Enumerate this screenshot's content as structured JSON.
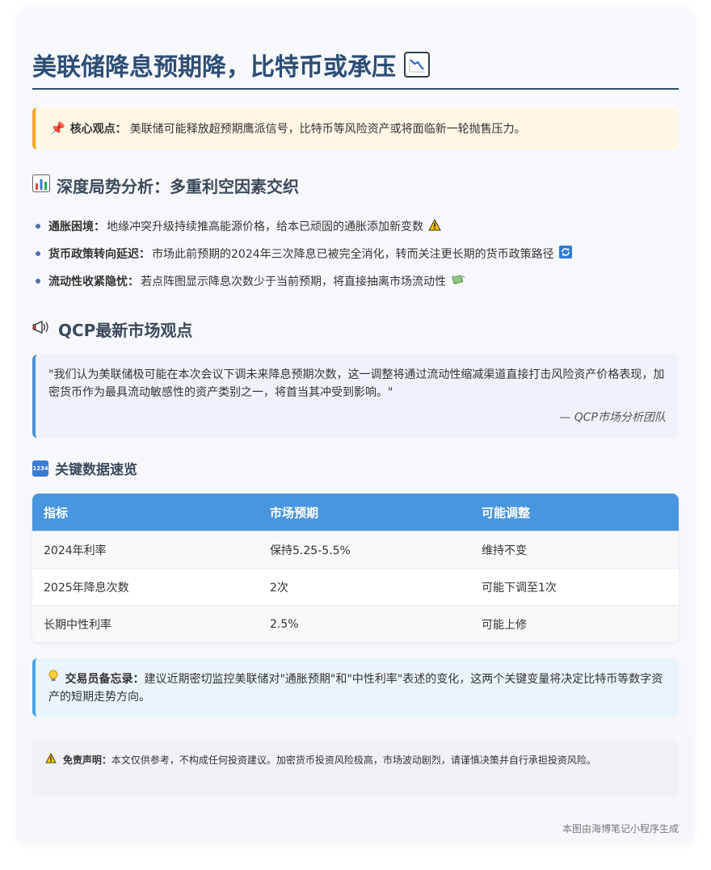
{
  "title": "美联储降息预期降，比特币或承压",
  "title_icon": "chart-decreasing-icon",
  "core": {
    "label": "核心观点：",
    "text": "美联储可能释放超预期鹰派信号，比特币等风险资产或将面临新一轮抛售压力。"
  },
  "analysis": {
    "heading": "深度局势分析：多重利空因素交织",
    "items": [
      {
        "label": "通胀困境：",
        "text": "地缘冲突升级持续推高能源价格，给本已顽固的通胀添加新变数",
        "icon": "warning-icon"
      },
      {
        "label": "货币政策转向延迟：",
        "text": "市场此前预期的2024年三次降息已被完全消化，转而关注更长期的货币政策路径",
        "icon": "refresh-icon"
      },
      {
        "label": "流动性收紧隐忧：",
        "text": "若点阵图显示降息次数少于当前预期，将直接抽离市场流动性",
        "icon": "money-wings-icon"
      }
    ]
  },
  "qcp": {
    "heading": "QCP最新市场观点",
    "quote": "\"我们认为美联储极可能在本次会议下调未来降息预期次数，这一调整将通过流动性缩减渠道直接打击风险资产价格表现，加密货币作为最具流动敏感性的资产类别之一，将首当其冲受到影响。\"",
    "source": "— QCP市场分析团队"
  },
  "data_section": {
    "heading": "关键数据速览",
    "num_icon": "1234",
    "columns": [
      "指标",
      "市场预期",
      "可能调整"
    ],
    "rows": [
      [
        "2024年利率",
        "保持5.25-5.5%",
        "维持不变"
      ],
      [
        "2025年降息次数",
        "2次",
        "可能下调至1次"
      ],
      [
        "长期中性利率",
        "2.5%",
        "可能上修"
      ]
    ]
  },
  "memo": {
    "label": "交易员备忘录：",
    "text": "建议近期密切监控美联储对\"通胀预期\"和\"中性利率\"表述的变化，这两个关键变量将决定比特币等数字资产的短期走势方向。"
  },
  "disclaimer": {
    "label": "免责声明：",
    "text": "本文仅供参考，不构成任何投资建议。加密货币投资风险极高，市场波动剧烈，请谨慎决策并自行承担投资风险。"
  },
  "footer": "本图由海博笔记小程序生成"
}
